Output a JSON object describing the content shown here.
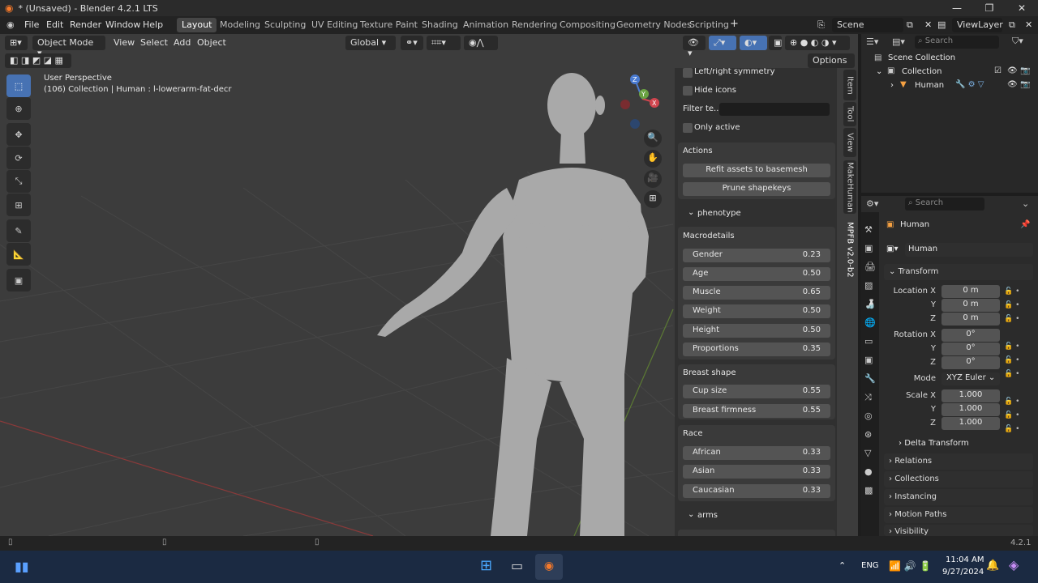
{
  "window": {
    "title": "* (Unsaved) - Blender 4.2.1 LTS"
  },
  "menu": [
    "File",
    "Edit",
    "Render",
    "Window",
    "Help"
  ],
  "workspaces": [
    "Layout",
    "Modeling",
    "Sculpting",
    "UV Editing",
    "Texture Paint",
    "Shading",
    "Animation",
    "Rendering",
    "Compositing",
    "Geometry Nodes",
    "Scripting"
  ],
  "topright": {
    "scene": "Scene",
    "view_layer": "ViewLayer"
  },
  "viewport_header": {
    "mode": "Object Mode",
    "menus": [
      "View",
      "Select",
      "Add",
      "Object"
    ],
    "orientation": "Global",
    "options": "Options"
  },
  "viewport": {
    "perspective": "User Perspective",
    "info": "(106) Collection | Human : l-lowerarm-fat-decr"
  },
  "npanel": {
    "checks": [
      {
        "label": "Left/right symmetry"
      },
      {
        "label": "Hide icons"
      },
      {
        "label": "Only active"
      }
    ],
    "filter_label": "Filter te...",
    "actions_title": "Actions",
    "actions": [
      "Refit assets to basemesh",
      "Prune shapekeys"
    ],
    "phenotype": "phenotype",
    "macro_title": "Macrodetails",
    "macro": [
      {
        "label": "Gender",
        "value": "0.23"
      },
      {
        "label": "Age",
        "value": "0.50"
      },
      {
        "label": "Muscle",
        "value": "0.65"
      },
      {
        "label": "Weight",
        "value": "0.50"
      },
      {
        "label": "Height",
        "value": "0.50"
      },
      {
        "label": "Proportions",
        "value": "0.35"
      }
    ],
    "breast_title": "Breast shape",
    "breast": [
      {
        "label": "Cup size",
        "value": "0.55"
      },
      {
        "label": "Breast firmness",
        "value": "0.55"
      }
    ],
    "race_title": "Race",
    "race": [
      {
        "label": "African",
        "value": "0.33"
      },
      {
        "label": "Asian",
        "value": "0.33"
      },
      {
        "label": "Caucasian",
        "value": "0.33"
      }
    ],
    "arms": "arms"
  },
  "side_tabs": [
    "Item",
    "Tool",
    "View",
    "MakeHuman",
    "MPFB v2.0-b2"
  ],
  "outliner": {
    "search": "Search",
    "root": "Scene Collection",
    "collection": "Collection",
    "object": "Human"
  },
  "properties": {
    "search": "Search",
    "object": "Human",
    "object_field": "Human",
    "transform": "Transform",
    "location": [
      {
        "axis": "Location X",
        "value": "0 m"
      },
      {
        "axis": "Y",
        "value": "0 m"
      },
      {
        "axis": "Z",
        "value": "0 m"
      }
    ],
    "rotation": [
      {
        "axis": "Rotation X",
        "value": "0°"
      },
      {
        "axis": "Y",
        "value": "0°"
      },
      {
        "axis": "Z",
        "value": "0°"
      }
    ],
    "mode_label": "Mode",
    "mode_value": "XYZ Euler",
    "scale": [
      {
        "axis": "Scale X",
        "value": "1.000"
      },
      {
        "axis": "Y",
        "value": "1.000"
      },
      {
        "axis": "Z",
        "value": "1.000"
      }
    ],
    "delta": "Delta Transform",
    "sections": [
      "Relations",
      "Collections",
      "Instancing",
      "Motion Paths",
      "Visibility"
    ]
  },
  "status": {
    "version": "4.2.1"
  },
  "taskbar": {
    "lang": "ENG",
    "time": "11:04 AM",
    "date": "9/27/2024"
  }
}
